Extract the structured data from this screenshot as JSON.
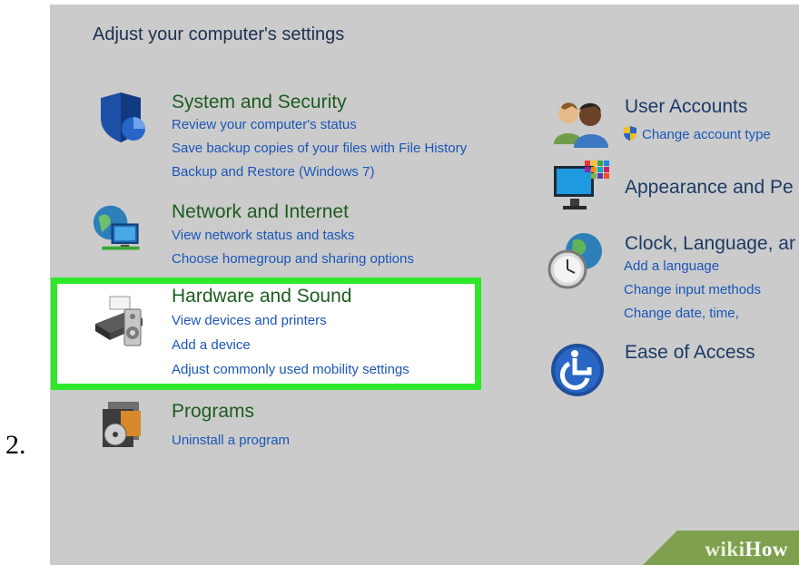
{
  "step_number": "2.",
  "panel": {
    "title": "Adjust your computer's settings"
  },
  "categories_left": [
    {
      "title": "System and Security",
      "icon": "shield-icon",
      "links": [
        "Review your computer's status",
        "Save backup copies of your files with File History",
        "Backup and Restore (Windows 7)"
      ]
    },
    {
      "title": "Network and Internet",
      "icon": "network-globe-icon",
      "links": [
        "View network status and tasks",
        "Choose homegroup and sharing options"
      ]
    },
    {
      "title": "Hardware and Sound",
      "icon": "printer-speaker-icon",
      "highlighted": true,
      "links": [
        "View devices and printers",
        "Add a device",
        "Adjust commonly used mobility settings"
      ]
    },
    {
      "title": "Programs",
      "icon": "programs-disc-icon",
      "links": [
        "Uninstall a program"
      ]
    }
  ],
  "categories_right": [
    {
      "title": "User Accounts",
      "icon": "users-icon",
      "links": [
        "Change account type"
      ]
    },
    {
      "title": "Appearance and Pe",
      "icon": "monitor-icon",
      "links": []
    },
    {
      "title": "Clock, Language, ar",
      "icon": "clock-globe-icon",
      "links": [
        "Add a language",
        "Change input methods",
        "Change date, time,"
      ]
    },
    {
      "title": "Ease of Access",
      "icon": "ease-of-access-icon",
      "links": []
    }
  ],
  "watermark": {
    "wiki": "wiki",
    "how": "How"
  },
  "colors": {
    "panel_bg": "#cbcbcb",
    "highlight_border": "#2ee82a",
    "link": "#1a56b8",
    "category_title": "#1d5c1f",
    "wikihow_green": "#7fa14f"
  }
}
